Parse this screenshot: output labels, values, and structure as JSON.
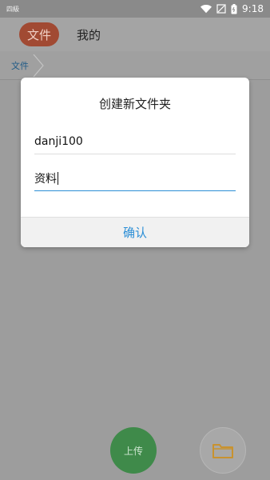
{
  "status_bar": {
    "left_label": "四級",
    "time": "9:18"
  },
  "top_tabs": {
    "items": [
      {
        "label": "文件",
        "active": true
      },
      {
        "label": "我的",
        "active": false
      }
    ]
  },
  "breadcrumb": {
    "items": [
      "文件"
    ]
  },
  "dialog": {
    "title": "创建新文件夹",
    "field_1_value": "danji100",
    "field_2_value": "资料",
    "confirm_label": "确认"
  },
  "bottom_actions": {
    "upload_label": "上传"
  },
  "colors": {
    "active_tab": "#a14a33",
    "accent_blue": "#2b8ed6",
    "upload_fab": "#3f8a4a",
    "folder_icon": "#c8922f"
  }
}
